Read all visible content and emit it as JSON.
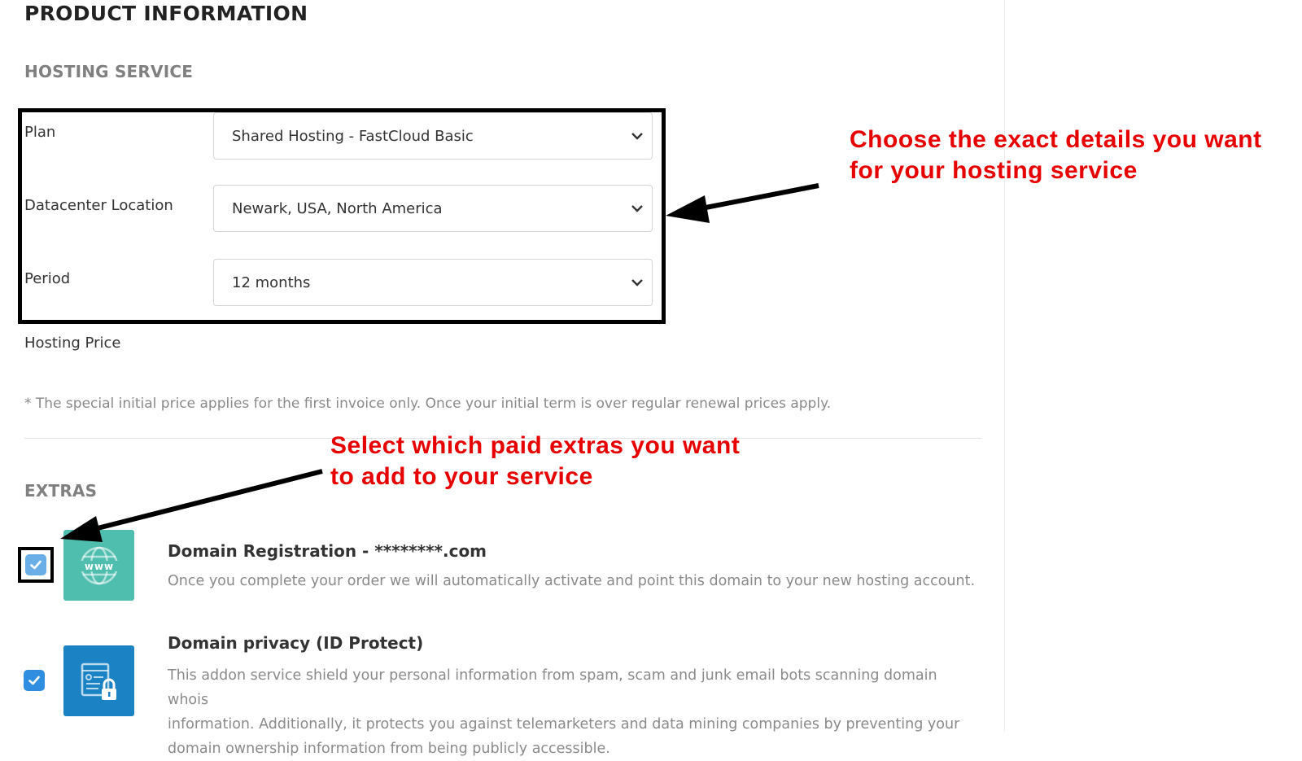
{
  "page": {
    "title": "PRODUCT INFORMATION"
  },
  "hosting": {
    "section_title": "HOSTING SERVICE",
    "fields": [
      {
        "label": "Plan",
        "value": "Shared Hosting - FastCloud Basic"
      },
      {
        "label": "Datacenter Location",
        "value": "Newark, USA, North America"
      },
      {
        "label": "Period",
        "value": "12 months"
      }
    ],
    "price_label": "Hosting Price",
    "footnote": "* The special initial price applies for the first invoice only. Once your initial term is over regular renewal prices apply."
  },
  "extras": {
    "section_title": "EXTRAS",
    "items": [
      {
        "title": "Domain Registration - ********.com",
        "description": "Once you complete your order we will automatically activate and point this domain to your new hosting account.",
        "checked": true,
        "icon": "www-globe-icon"
      },
      {
        "title": "Domain privacy (ID Protect)",
        "description_lines": [
          "This addon service shield your personal information from spam, scam and junk email bots scanning domain whois",
          "information. Additionally, it protects you against telemarketers and data mining companies by preventing your",
          "domain ownership information from being publicly accessible."
        ],
        "checked": true,
        "icon": "document-lock-icon"
      }
    ]
  },
  "annotations": {
    "hosting_note": [
      "Choose the exact details you want",
      "for your hosting service"
    ],
    "extras_note": [
      "Select which paid extras you want",
      "to add to your service"
    ]
  },
  "colors": {
    "annotation_text": "#e60000",
    "checkbox_blue": "#2f8ee0",
    "domain_tile": "#4fbeaf",
    "privacy_tile": "#1b82c4",
    "highlight_border": "#000000"
  }
}
